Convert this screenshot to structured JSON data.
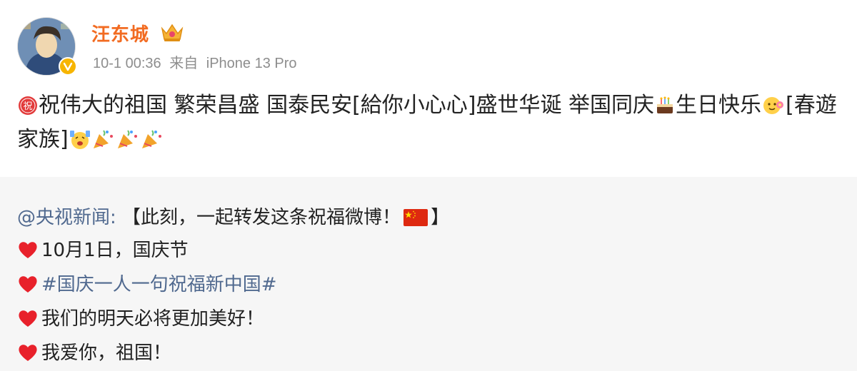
{
  "author": {
    "name": "汪东城",
    "badge_icon": "crown-icon",
    "verified_icon": "verified-v-icon",
    "time": "10-1 00:36",
    "source_prefix": "来自",
    "device": "iPhone 13 Pro"
  },
  "post": {
    "part1": "祝伟大的祖国 繁荣昌盛 国泰民安[給你小心心]盛世华诞 举国同庆",
    "part2": "生日快乐",
    "part3": "[春遊家族]",
    "emoji_icons": [
      "zhu-red-circle-icon",
      "birthday-cake-icon",
      "flower-face-icon",
      "cheering-face-icon",
      "party-popper-icon"
    ]
  },
  "repost": {
    "mention": "@央视新闻",
    "colon": ":",
    "headline": "【此刻，一起转发这条祝福微博！",
    "headline_end": "】",
    "lines": [
      "10月1日，国庆节",
      "#国庆一人一句祝福新中国#",
      "我们的明天必将更加美好！",
      "我爱你，祖国！"
    ]
  },
  "colors": {
    "name": "#f26b21",
    "meta": "#8d8d8d",
    "link": "#50698f",
    "repost_bg": "#f6f6f6",
    "heart": "#e8212b"
  }
}
